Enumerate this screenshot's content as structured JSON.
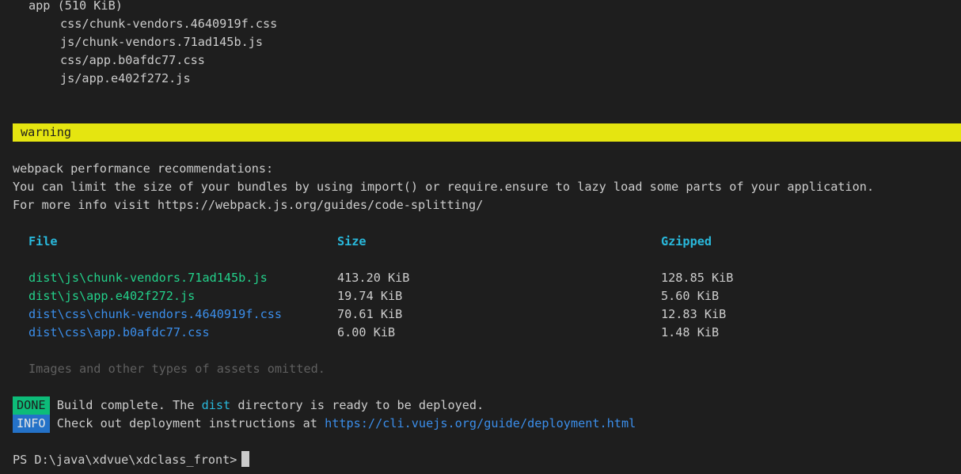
{
  "assets": {
    "group_label": "app (510 KiB)",
    "files": [
      "css/chunk-vendors.4640919f.css",
      "js/chunk-vendors.71ad145b.js",
      "css/app.b0afdc77.css",
      "js/app.e402f272.js"
    ]
  },
  "warning": {
    "label": "warning",
    "title": "webpack performance recommendations:",
    "line1": "You can limit the size of your bundles by using import() or require.ensure to lazy load some parts of your application.",
    "line2": "For more info visit https://webpack.js.org/guides/code-splitting/"
  },
  "table": {
    "headers": {
      "file": "File",
      "size": "Size",
      "gzipped": "Gzipped"
    },
    "rows": [
      {
        "file": "dist\\js\\chunk-vendors.71ad145b.js",
        "size": "413.20 KiB",
        "gzipped": "128.85 KiB",
        "kind": "js"
      },
      {
        "file": "dist\\js\\app.e402f272.js",
        "size": "19.74 KiB",
        "gzipped": "5.60 KiB",
        "kind": "js"
      },
      {
        "file": "dist\\css\\chunk-vendors.4640919f.css",
        "size": "70.61 KiB",
        "gzipped": "12.83 KiB",
        "kind": "css"
      },
      {
        "file": "dist\\css\\app.b0afdc77.css",
        "size": "6.00 KiB",
        "gzipped": "1.48 KiB",
        "kind": "css"
      }
    ],
    "note": "Images and other types of assets omitted."
  },
  "done": {
    "badge": "DONE",
    "text_before": "Build complete. The ",
    "dir": "dist",
    "text_after": " directory is ready to be deployed."
  },
  "info": {
    "badge": "INFO",
    "text": "Check out deployment instructions at ",
    "link": "https://cli.vuejs.org/guide/deployment.html"
  },
  "prompt": {
    "text": "PS D:\\java\\xdvue\\xdclass_front>"
  },
  "colors": {
    "background": "#1e1e1e",
    "warning_bg": "#e5e510",
    "done_bg": "#0dbc79",
    "info_bg": "#2472c8",
    "header": "#29b8db",
    "js": "#23d18b",
    "css": "#3b8eea"
  }
}
